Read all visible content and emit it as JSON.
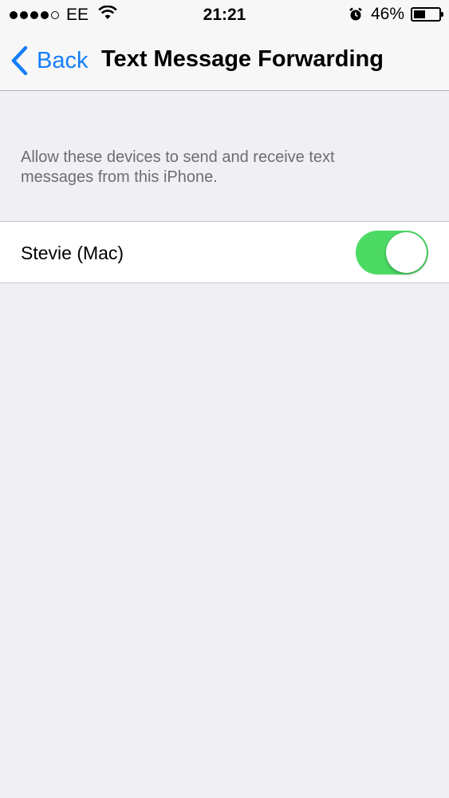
{
  "status_bar": {
    "signal_bars_filled": 4,
    "signal_bars_total": 5,
    "carrier": "EE",
    "time": "21:21",
    "battery_percent": "46%",
    "battery_level": 0.46
  },
  "nav": {
    "back_label": "Back",
    "title": "Text Message Forwarding"
  },
  "content": {
    "description_line1": "Allow these devices to send and receive text",
    "description_line2": "messages from this iPhone.",
    "devices": [
      {
        "label": "Stevie (Mac)",
        "enabled": true
      }
    ]
  },
  "colors": {
    "accent": "#157efb",
    "toggle_on": "#4cd964",
    "background": "#efeff4"
  }
}
